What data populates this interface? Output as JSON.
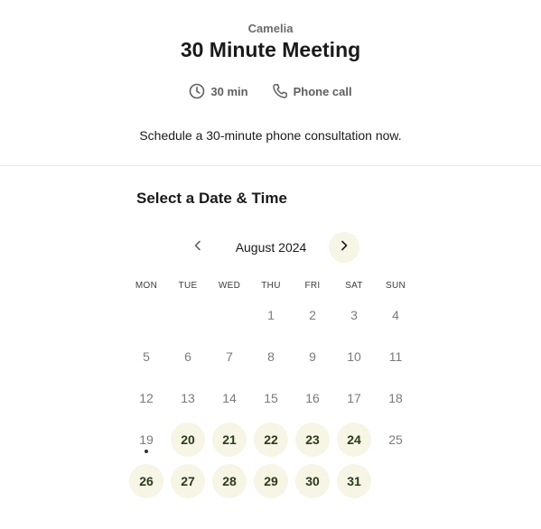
{
  "header": {
    "host": "Camelia",
    "title": "30 Minute Meeting",
    "duration": "30 min",
    "location": "Phone call",
    "description": "Schedule a 30-minute phone consultation now."
  },
  "calendar": {
    "section_title": "Select a Date & Time",
    "month_label": "August 2024",
    "weekdays": [
      "MON",
      "TUE",
      "WED",
      "THU",
      "FRI",
      "SAT",
      "SUN"
    ],
    "days": [
      {
        "d": "1",
        "available": false
      },
      {
        "d": "2",
        "available": false
      },
      {
        "d": "3",
        "available": false
      },
      {
        "d": "4",
        "available": false
      },
      {
        "d": "5",
        "available": false
      },
      {
        "d": "6",
        "available": false
      },
      {
        "d": "7",
        "available": false
      },
      {
        "d": "8",
        "available": false
      },
      {
        "d": "9",
        "available": false
      },
      {
        "d": "10",
        "available": false
      },
      {
        "d": "11",
        "available": false
      },
      {
        "d": "12",
        "available": false
      },
      {
        "d": "13",
        "available": false
      },
      {
        "d": "14",
        "available": false
      },
      {
        "d": "15",
        "available": false
      },
      {
        "d": "16",
        "available": false
      },
      {
        "d": "17",
        "available": false
      },
      {
        "d": "18",
        "available": false
      },
      {
        "d": "19",
        "available": false,
        "today": true
      },
      {
        "d": "20",
        "available": true
      },
      {
        "d": "21",
        "available": true
      },
      {
        "d": "22",
        "available": true
      },
      {
        "d": "23",
        "available": true
      },
      {
        "d": "24",
        "available": true
      },
      {
        "d": "25",
        "available": false
      },
      {
        "d": "26",
        "available": true
      },
      {
        "d": "27",
        "available": true
      },
      {
        "d": "28",
        "available": true
      },
      {
        "d": "29",
        "available": true
      },
      {
        "d": "30",
        "available": true
      },
      {
        "d": "31",
        "available": true
      }
    ],
    "first_weekday_index": 3
  },
  "icons": {
    "duration": "clock-icon",
    "location": "phone-icon",
    "prev": "chevron-left-icon",
    "next": "chevron-right-icon"
  },
  "colors": {
    "available_bg": "#f6f5e6",
    "available_text": "#2b3a1a"
  }
}
